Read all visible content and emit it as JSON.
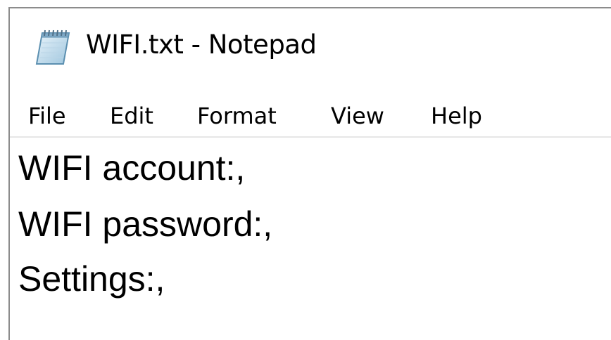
{
  "window": {
    "title": "WIFI.txt - Notepad",
    "icon": "notepad-icon"
  },
  "menu": {
    "items": [
      "File",
      "Edit",
      "Format",
      "View",
      "Help"
    ]
  },
  "editor": {
    "lines": [
      "WIFI account:,",
      "WIFI password:,",
      "Settings:,"
    ]
  }
}
